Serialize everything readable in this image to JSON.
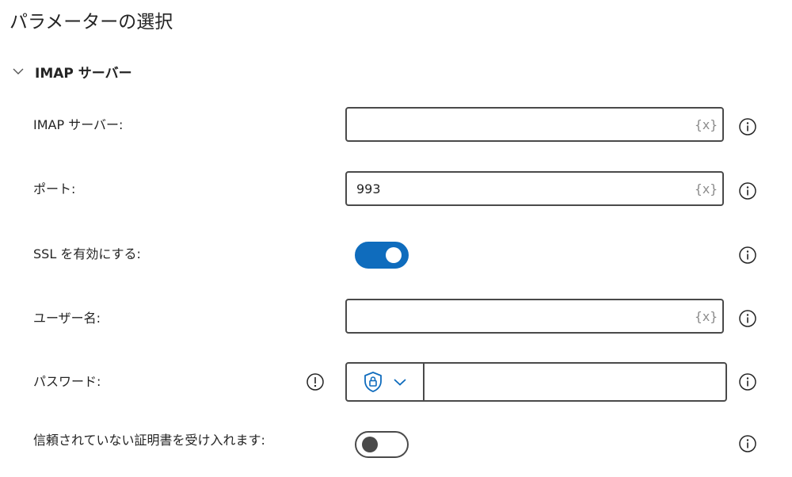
{
  "page": {
    "title": "パラメーターの選択"
  },
  "section": {
    "title": "IMAP サーバー",
    "expanded": true
  },
  "fields": {
    "imap_server": {
      "label": "IMAP サーバー:",
      "value": "",
      "variable_icon": "{x}"
    },
    "port": {
      "label": "ポート:",
      "value": "993",
      "variable_icon": "{x}"
    },
    "enable_ssl": {
      "label": "SSL を有効にする:",
      "on": true
    },
    "username": {
      "label": "ユーザー名:",
      "value": "",
      "variable_icon": "{x}"
    },
    "password": {
      "label": "パスワード:",
      "value": "",
      "type_icon": "shield-lock-icon"
    },
    "accept_untrusted_cert": {
      "label": "信頼されていない証明書を受け入れます:",
      "on": false
    }
  },
  "colors": {
    "accent": "#0f6cbd",
    "text": "#242424",
    "border": "#4a4a4a",
    "muted": "#8a8a8a"
  }
}
